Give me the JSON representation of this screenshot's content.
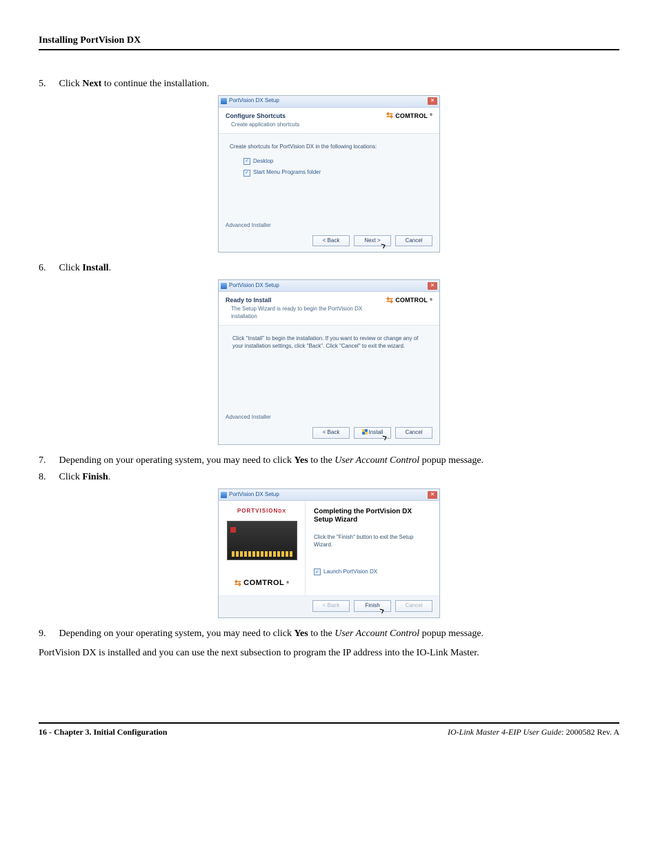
{
  "header": {
    "title": "Installing PortVision DX"
  },
  "steps": {
    "s5": {
      "num": "5.",
      "pre": "Click ",
      "bold": "Next",
      "post": " to continue the installation."
    },
    "s6": {
      "num": "6.",
      "pre": "Click ",
      "bold": "Install",
      "post": "."
    },
    "s7": {
      "num": "7.",
      "pre": "Depending on your operating system, you may need to click ",
      "bold": "Yes",
      "mid": " to the ",
      "italic": "User Account Control",
      "post2": " popup message."
    },
    "s8": {
      "num": "8.",
      "pre": "Click ",
      "bold": "Finish",
      "post": "."
    },
    "s9": {
      "num": "9.",
      "pre": "Depending on your operating system, you may need to click ",
      "bold": "Yes",
      "mid": " to the ",
      "italic": "User Account Control",
      "post2": " popup message."
    }
  },
  "closing": "PortVision DX is installed and you can use the next subsection to program the IP address into the IO-Link Master.",
  "shot1": {
    "title": "PortVision DX Setup",
    "heading": "Configure Shortcuts",
    "sub": "Create application shortcuts",
    "brand": "COMTROL",
    "body_line": "Create shortcuts for PortVision DX in the following locations:",
    "cb1": "Desktop",
    "cb2": "Start Menu Programs folder",
    "group": "Advanced Installer",
    "btn_back": "< Back",
    "btn_next": "Next >",
    "btn_cancel": "Cancel"
  },
  "shot2": {
    "title": "PortVision DX Setup",
    "heading": "Ready to Install",
    "sub": "The Setup Wizard is ready to begin the PortVision DX installation",
    "brand": "COMTROL",
    "body_line": "Click \"Install\" to begin the installation.  If you want to review or change any of your installation settings, click \"Back\".  Click \"Cancel\" to exit the wizard.",
    "group": "Advanced Installer",
    "btn_back": "< Back",
    "btn_install": "Install",
    "btn_cancel": "Cancel"
  },
  "shot3": {
    "title": "PortVision DX Setup",
    "logo": "PORTVISION",
    "logo_dx": "DX",
    "brand": "COMTROL",
    "big": "Completing the PortVision DX Setup Wizard",
    "msg": "Click the \"Finish\" button to exit the Setup Wizard.",
    "cb": "Launch PortVision DX",
    "btn_back": "< Back",
    "btn_finish": "Finish",
    "btn_cancel": "Cancel"
  },
  "footer": {
    "left": "16 - Chapter 3. Initial Configuration",
    "right_italic": "IO-Link Master 4-EIP User Guide",
    "right_rest": ": 2000582 Rev. A"
  }
}
